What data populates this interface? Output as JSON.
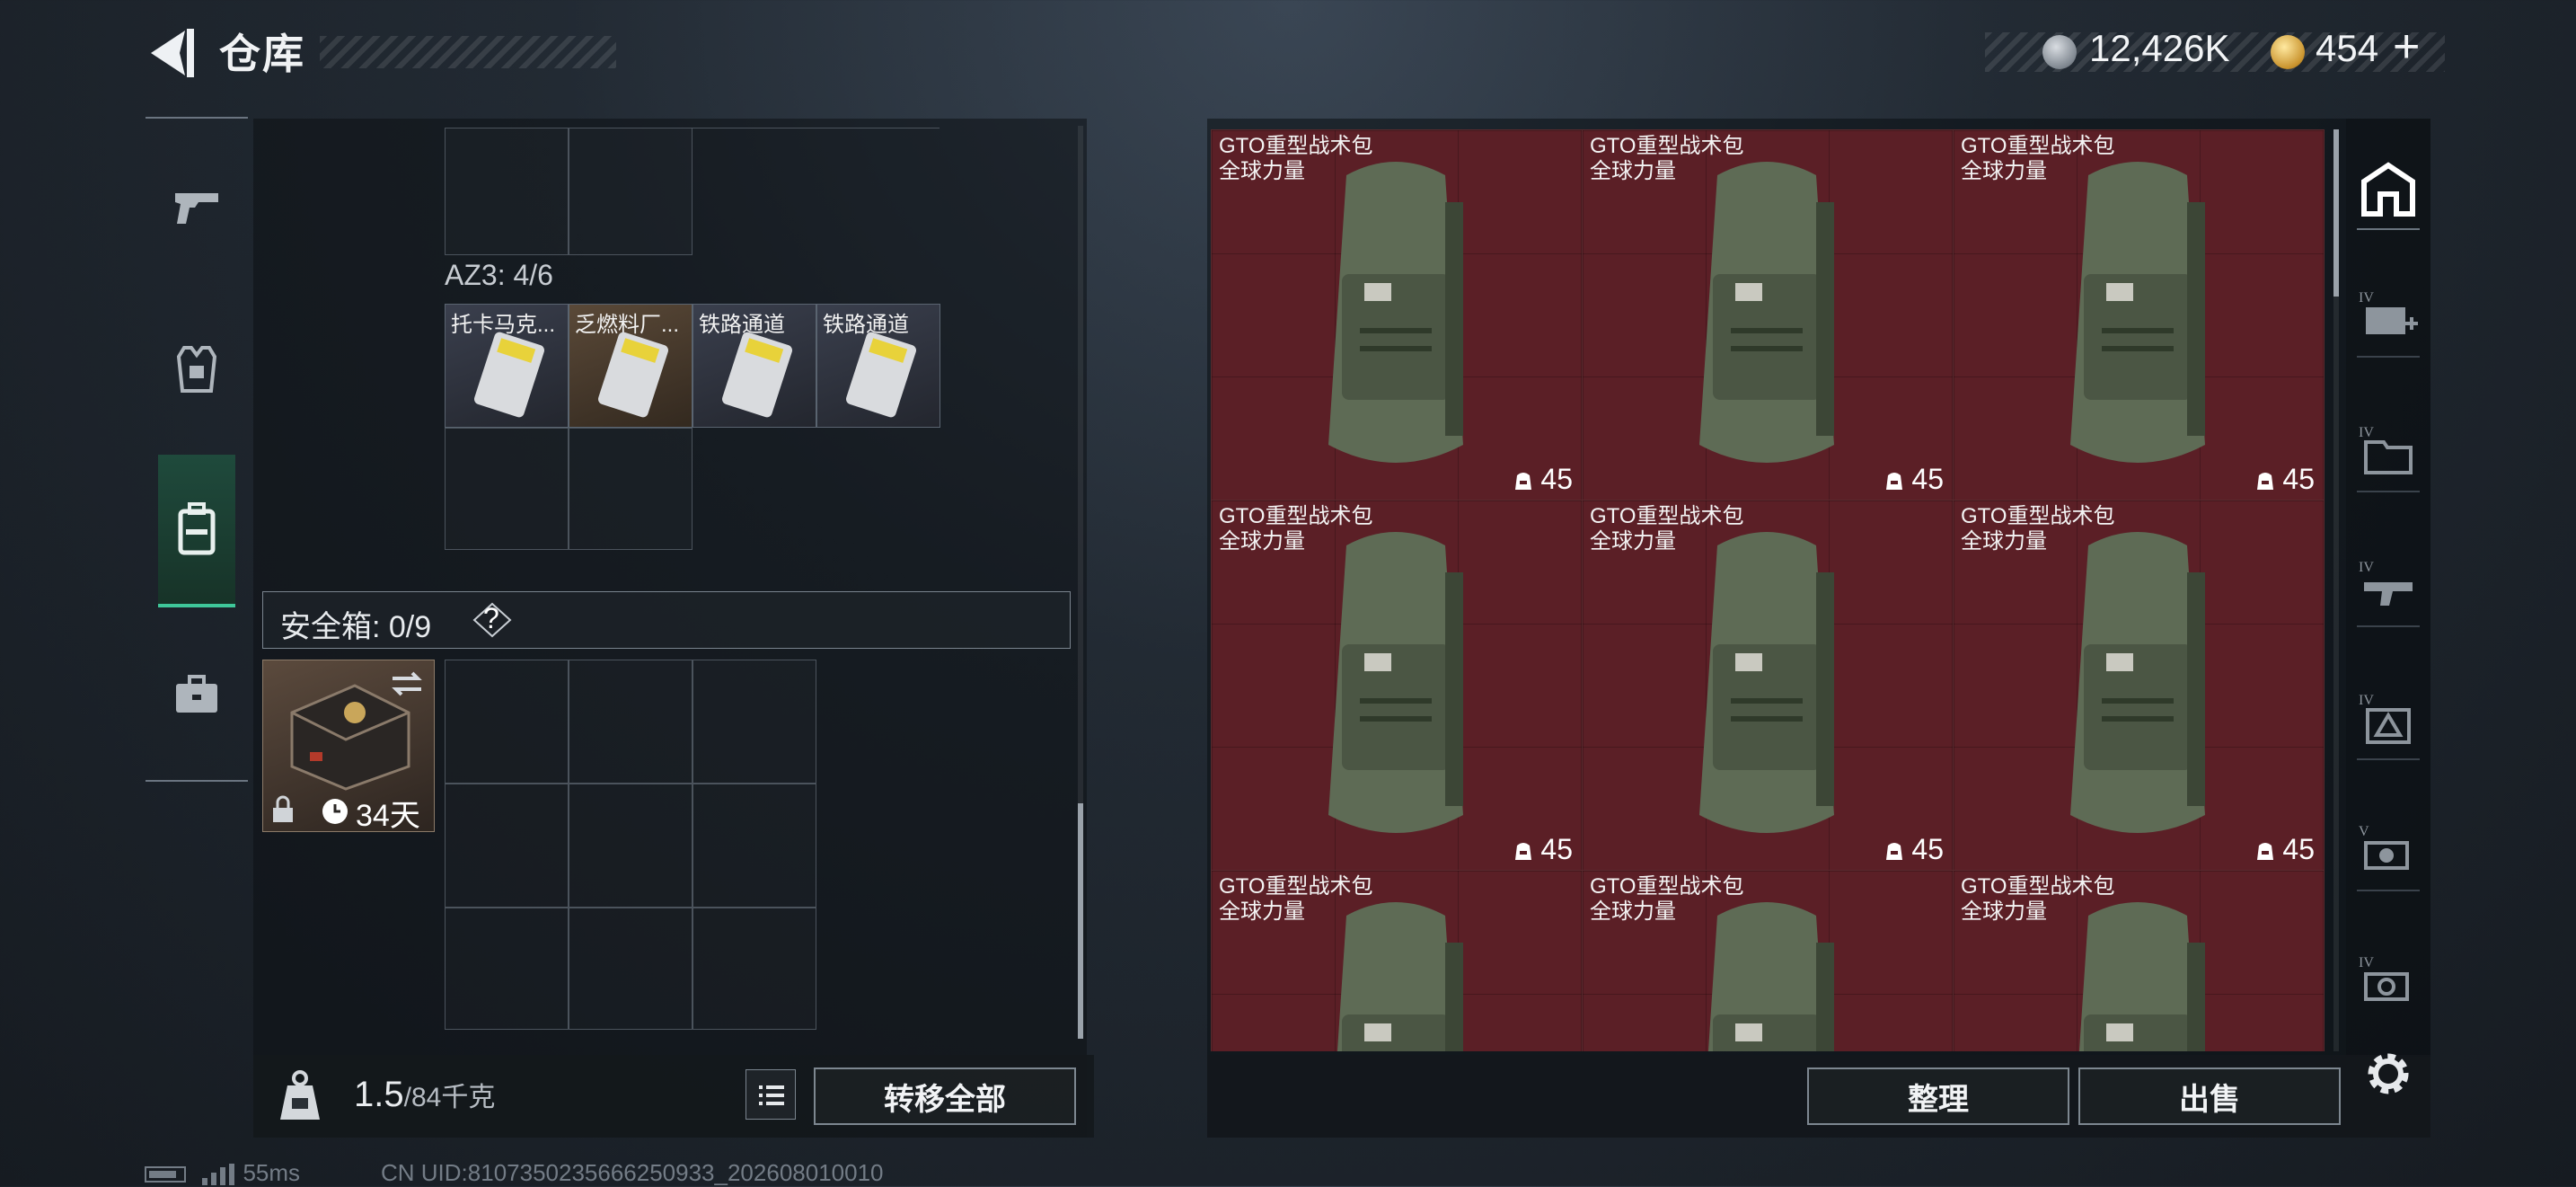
{
  "header": {
    "title": "仓库"
  },
  "currency": {
    "silver": "12,426K",
    "gold": "454",
    "plus": "+"
  },
  "left": {
    "az3_label": "AZ3: 4/6",
    "items": [
      {
        "label": "托卡马克..."
      },
      {
        "label": "乏燃料厂..."
      },
      {
        "label": "铁路通道"
      },
      {
        "label": "铁路通道"
      }
    ],
    "safe_label": "安全箱: 0/9",
    "safe_help": "?",
    "safebox_days": "34天"
  },
  "weight": {
    "value": "1.5",
    "max": "/84千克"
  },
  "buttons": {
    "transfer_all": "转移全部",
    "sort": "整理",
    "sell": "出售"
  },
  "stash": {
    "items": [
      {
        "name": "GTO重型战术包",
        "sub": "全球力量",
        "capacity": "45"
      },
      {
        "name": "GTO重型战术包",
        "sub": "全球力量",
        "capacity": "45"
      },
      {
        "name": "GTO重型战术包",
        "sub": "全球力量",
        "capacity": "45"
      },
      {
        "name": "GTO重型战术包",
        "sub": "全球力量",
        "capacity": "45"
      },
      {
        "name": "GTO重型战术包",
        "sub": "全球力量",
        "capacity": "45"
      },
      {
        "name": "GTO重型战术包",
        "sub": "全球力量",
        "capacity": "45"
      },
      {
        "name": "GTO重型战术包",
        "sub": "全球力量",
        "capacity": ""
      },
      {
        "name": "GTO重型战术包",
        "sub": "全球力量",
        "capacity": ""
      },
      {
        "name": "GTO重型战术包",
        "sub": "全球力量",
        "capacity": ""
      }
    ]
  },
  "status": {
    "ping": "55ms",
    "uid": "CN UID:8107350235666250933_202608010010"
  },
  "colors": {
    "accent": "#3fc79a",
    "stash_bg": "#5b1f26"
  }
}
